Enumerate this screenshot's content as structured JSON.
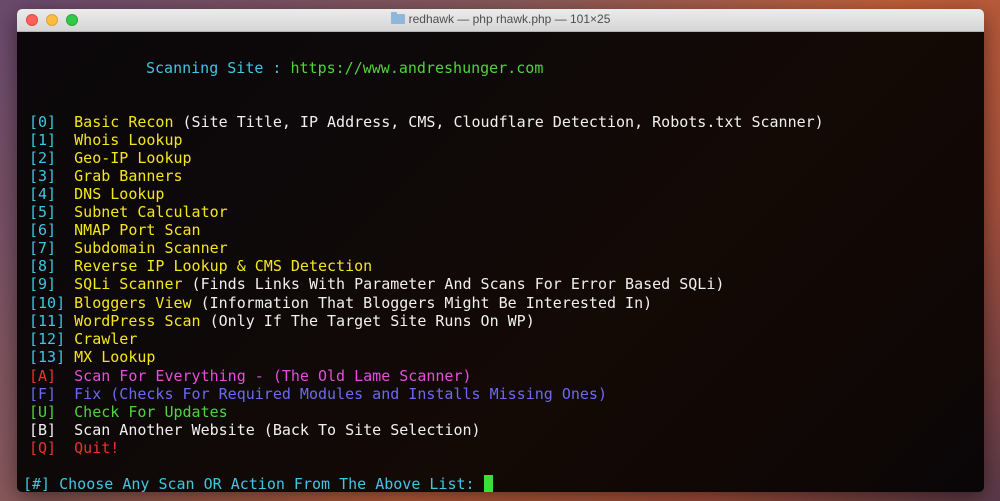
{
  "window": {
    "title": "redhawk — php rhawk.php — 101×25"
  },
  "terminal": {
    "scan_label": "Scanning Site : ",
    "scan_url": "https://www.andreshunger.com",
    "menu": [
      {
        "key": "[0]",
        "name": "Basic Recon",
        "desc": " (Site Title, IP Address, CMS, Cloudflare Detection, Robots.txt Scanner)"
      },
      {
        "key": "[1]",
        "name": "Whois Lookup",
        "desc": ""
      },
      {
        "key": "[2]",
        "name": "Geo-IP Lookup",
        "desc": ""
      },
      {
        "key": "[3]",
        "name": "Grab Banners",
        "desc": ""
      },
      {
        "key": "[4]",
        "name": "DNS Lookup",
        "desc": ""
      },
      {
        "key": "[5]",
        "name": "Subnet Calculator",
        "desc": ""
      },
      {
        "key": "[6]",
        "name": "NMAP Port Scan",
        "desc": ""
      },
      {
        "key": "[7]",
        "name": "Subdomain Scanner",
        "desc": ""
      },
      {
        "key": "[8]",
        "name": "Reverse IP Lookup & CMS Detection",
        "desc": ""
      },
      {
        "key": "[9]",
        "name": "SQLi Scanner",
        "desc": " (Finds Links With Parameter And Scans For Error Based SQLi)"
      },
      {
        "key": "[10]",
        "name": "Bloggers View",
        "desc": " (Information That Bloggers Might Be Interested In)"
      },
      {
        "key": "[11]",
        "name": "WordPress Scan",
        "desc": " (Only If The Target Site Runs On WP)"
      },
      {
        "key": "[12]",
        "name": "Crawler",
        "desc": ""
      },
      {
        "key": "[13]",
        "name": "MX Lookup",
        "desc": ""
      }
    ],
    "actions": {
      "a": {
        "key": "[A]",
        "label": "Scan For Everything - (The Old Lame Scanner)"
      },
      "f": {
        "key": "[F]",
        "label": "Fix (Checks For Required Modules and Installs Missing Ones)"
      },
      "u": {
        "key": "[U]",
        "label": "Check For Updates"
      },
      "b": {
        "key": "[B]",
        "label": "Scan Another Website (Back To Site Selection)"
      },
      "q": {
        "key": "[Q]",
        "label": "Quit!"
      }
    },
    "prompt": "[#] Choose Any Scan OR Action From The Above List: ",
    "colors": {
      "cyan": "#3fc6e0",
      "yellow": "#f4e61c",
      "magenta": "#e24fd9",
      "blue": "#6a6af0",
      "green": "#4fd43c",
      "red": "#ef3030",
      "cursor": "#3ae03a"
    }
  }
}
